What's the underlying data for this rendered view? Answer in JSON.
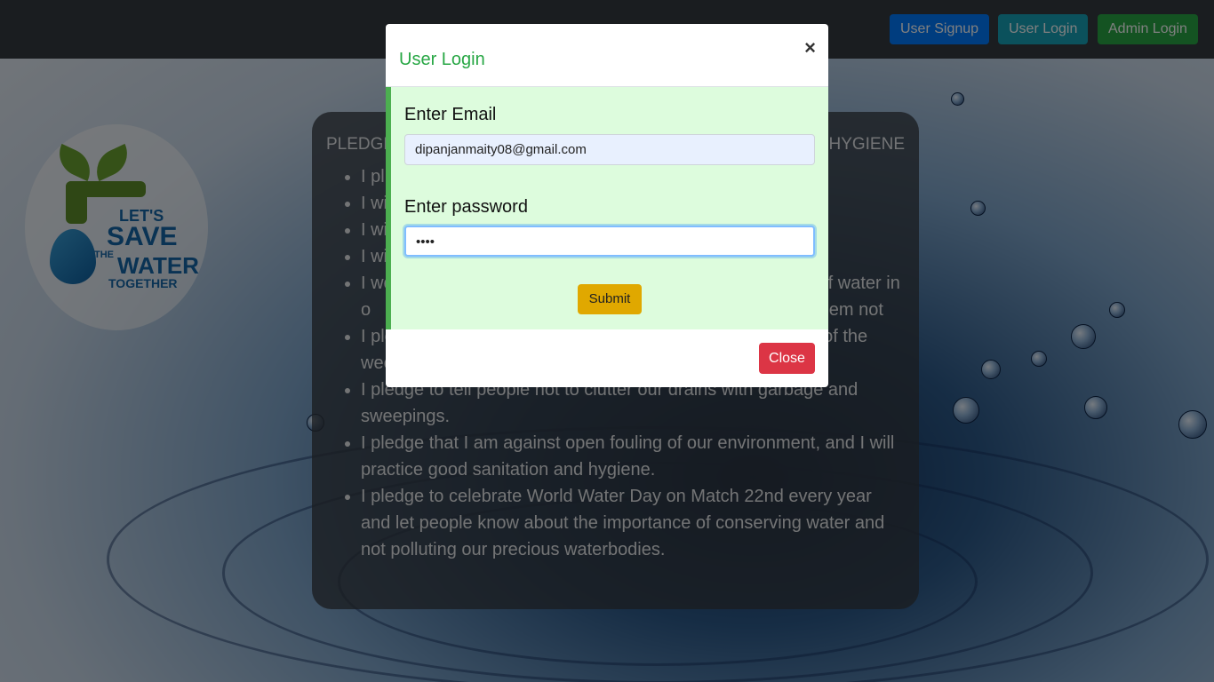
{
  "navbar": {
    "signup_label": "User Signup",
    "user_login_label": "User Login",
    "admin_login_label": "Admin Login"
  },
  "logo": {
    "line1": "LET'S",
    "line2": "SAVE",
    "line3_small": "THE",
    "line3": "WATER",
    "line4": "TOGETHER"
  },
  "pledge": {
    "title_left": "PLEDGE",
    "title_right": "HYGIENE",
    "items": [
      "I pl",
      "I wi",
      "I wi",
      "I wi",
      "I wo                                                                                   e of water in o                                                                                  uest them not",
      "I ple                                                                                    y of the week.",
      "I pledge to tell people not to clutter our drains with garbage and sweepings.",
      "I pledge that I am against open fouling of our environment, and I will practice good sanitation and hygiene.",
      "I pledge to celebrate World Water Day on Match 22nd every year and let people know about the importance of conserving water and not polluting our precious waterbodies."
    ]
  },
  "modal": {
    "title": "User Login",
    "close_x": "×",
    "email_label": "Enter Email",
    "email_value": "dipanjanmaity08@gmail.com",
    "password_label": "Enter password",
    "password_value": "••••",
    "submit_label": "Submit",
    "close_label": "Close"
  },
  "colors": {
    "navbar": "#343a40",
    "signup": "#007bff",
    "user_login": "#17a2b8",
    "admin_login": "#28a745",
    "modal_title": "#28a745",
    "modal_body": "#ddfcdd",
    "submit": "#e0a800",
    "close": "#dc3545"
  }
}
